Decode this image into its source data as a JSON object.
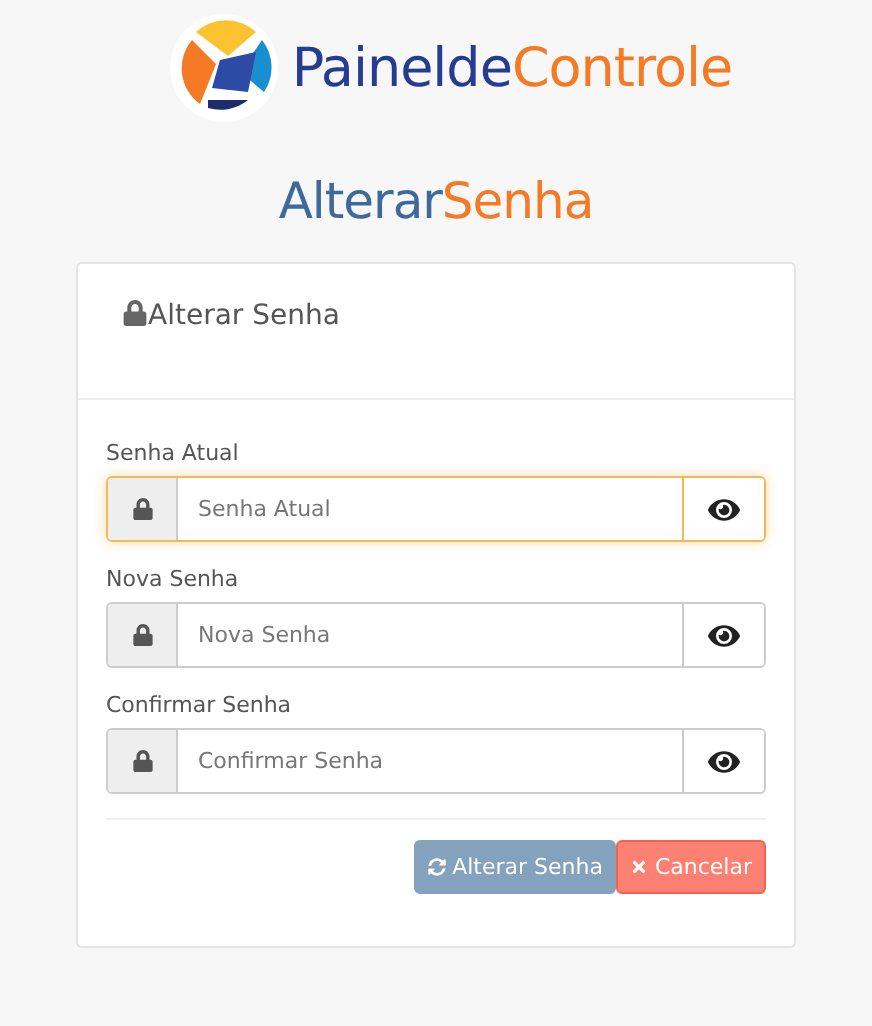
{
  "logo": {
    "parts": [
      {
        "text": "Painelde",
        "color": "#263c91"
      },
      {
        "text": "Controle",
        "color": "#f47a25"
      }
    ]
  },
  "heading": {
    "parts": [
      {
        "text": "Alterar",
        "color": "#3e6a9b"
      },
      {
        "text": "Senha",
        "color": "#f47a25"
      }
    ]
  },
  "panel": {
    "title": "Alterar Senha",
    "fields": [
      {
        "label": "Senha Atual",
        "placeholder": "Senha Atual",
        "focused": true
      },
      {
        "label": "Nova Senha",
        "placeholder": "Nova Senha",
        "focused": false
      },
      {
        "label": "Confirmar Senha",
        "placeholder": "Confirmar Senha",
        "focused": false
      }
    ],
    "buttons": [
      {
        "kind": "submit",
        "label": "Alterar Senha"
      },
      {
        "kind": "cancel",
        "label": "Cancelar"
      }
    ]
  }
}
